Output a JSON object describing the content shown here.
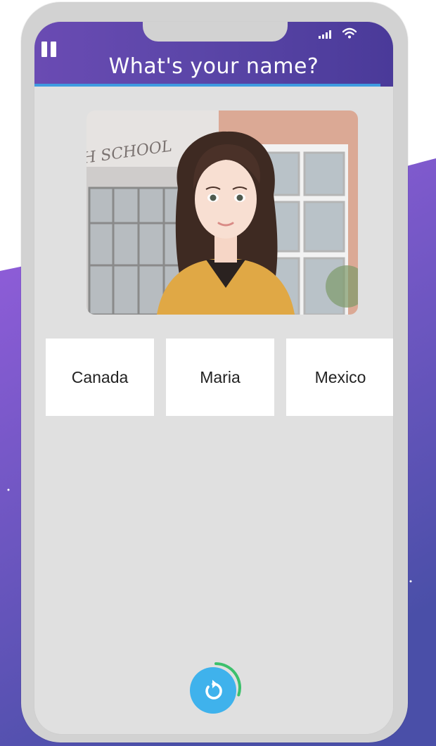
{
  "header": {
    "title": "What's your name?"
  },
  "scene": {
    "sign_text": "H SCHOOL"
  },
  "choices": [
    {
      "label": "Canada"
    },
    {
      "label": "Maria"
    },
    {
      "label": "Mexico"
    }
  ],
  "replay": {
    "progress": 0.3
  },
  "colors": {
    "header_start": "#6a4bb3",
    "header_end": "#4a3a99",
    "accent_line": "#3f9be0",
    "replay_button": "#3fb2ec",
    "replay_progress": "#3cc06c",
    "background_purple": "#8a56d6"
  },
  "icons": {
    "pause": "pause-icon",
    "signal": "signal-icon",
    "wifi": "wifi-icon",
    "replay": "replay-icon"
  }
}
